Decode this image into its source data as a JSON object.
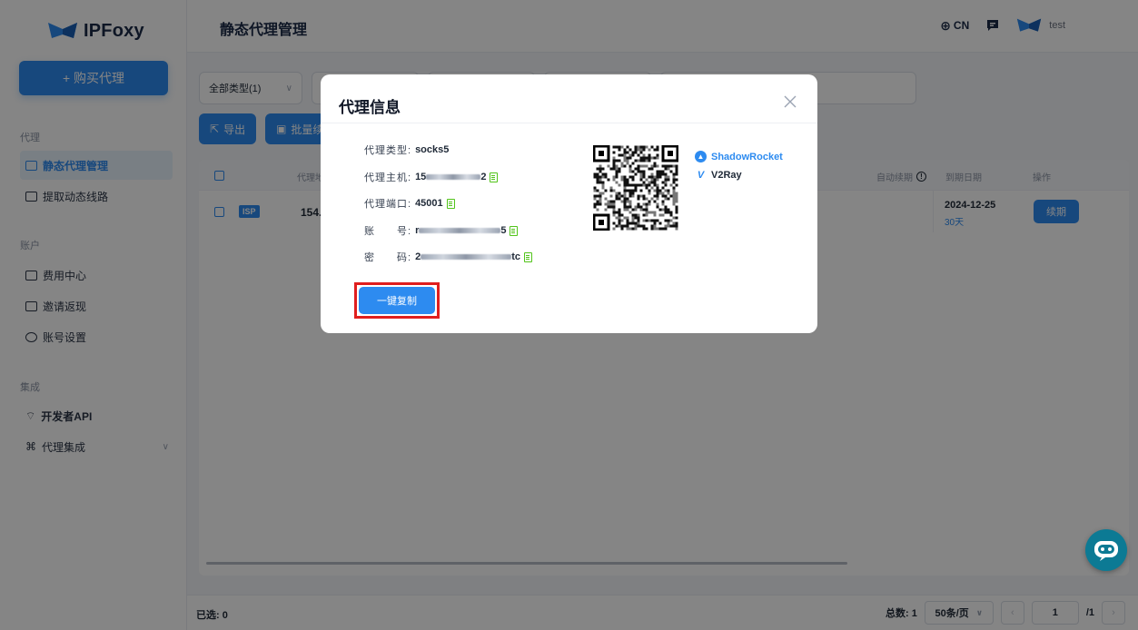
{
  "brand": {
    "name": "IPFoxy"
  },
  "sidebar": {
    "buy_button": "+ 购买代理",
    "sections": [
      {
        "title": "代理",
        "items": [
          {
            "label": "静态代理管理"
          },
          {
            "label": "提取动态线路"
          }
        ]
      },
      {
        "title": "账户",
        "items": [
          {
            "label": "费用中心"
          },
          {
            "label": "邀请返现"
          },
          {
            "label": "账号设置"
          }
        ]
      },
      {
        "title": "集成",
        "items": [
          {
            "label": "开发者API"
          },
          {
            "label": "代理集成"
          }
        ]
      }
    ]
  },
  "header": {
    "title": "静态代理管理",
    "lang": "CN",
    "username": "test"
  },
  "filters": {
    "type_select": "全部类型(1)"
  },
  "toolbar": {
    "export": "导出",
    "batch": "批量续"
  },
  "table": {
    "headers": {
      "proxy": "代理地",
      "auto_renew": "自动续期",
      "expire": "到期日期",
      "actions": "操作"
    },
    "row": {
      "tag": "ISP",
      "ip_prefix": "154.",
      "expire_date": "2024-12-25",
      "days_left": "30天",
      "renew_button": "续期"
    }
  },
  "footer": {
    "selected": "已选: 0",
    "total": "总数: 1",
    "page_size": "50条/页",
    "page": "1",
    "page_total": "/1"
  },
  "modal": {
    "title": "代理信息",
    "rows": [
      {
        "key": "代理类型:",
        "value": "socks5"
      },
      {
        "key": "代理主机:",
        "value_prefix": "15",
        "value_suffix": "2"
      },
      {
        "key": "代理端口:",
        "value": "45001"
      },
      {
        "key": "账　　号:",
        "value_prefix": "r",
        "value_suffix": "5"
      },
      {
        "key": "密　　码:",
        "value_prefix": "2",
        "value_suffix": "tc"
      }
    ],
    "apps": [
      {
        "name": "ShadowRocket",
        "color": "#2d8bf0"
      },
      {
        "name": "V2Ray",
        "color": "#1f2937"
      }
    ],
    "copy_all_button": "一键复制"
  },
  "colors": {
    "primary": "#2d8bf0",
    "success": "#25a244",
    "highlight": "#e01e1e"
  }
}
